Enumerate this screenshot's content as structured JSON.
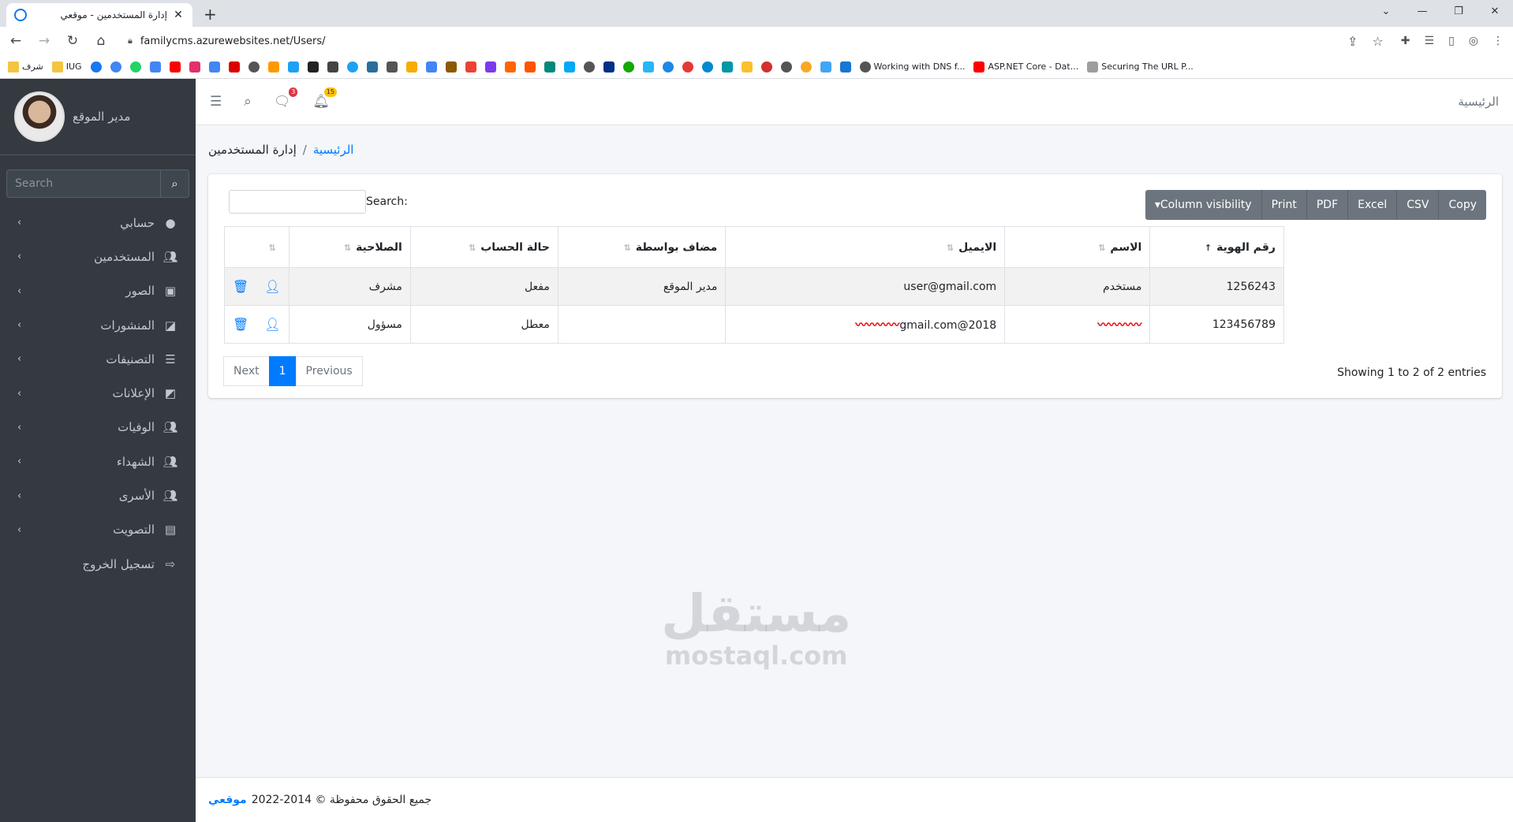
{
  "browser": {
    "tab_title": "إدارة المستخدمين - موقعي",
    "url": "familycms.azurewebsites.net/Users/",
    "bookmarks": [
      "شرف",
      "IUG",
      "Working with DNS f...",
      "ASP.NET Core - Dat...",
      "Securing The URL P..."
    ]
  },
  "sidebar": {
    "username": "مدير الموقع",
    "search_placeholder": "Search",
    "items": [
      {
        "label": "حسابي",
        "icon": "user-circle-icon"
      },
      {
        "label": "المستخدمين",
        "icon": "users-icon"
      },
      {
        "label": "الصور",
        "icon": "image-icon"
      },
      {
        "label": "المنشورات",
        "icon": "sticky-note-icon"
      },
      {
        "label": "التصنيفات",
        "icon": "list-icon"
      },
      {
        "label": "الإعلانات",
        "icon": "note-icon"
      },
      {
        "label": "الوفيات",
        "icon": "users-icon"
      },
      {
        "label": "الشهداء",
        "icon": "users-icon"
      },
      {
        "label": "الأسرى",
        "icon": "users-icon"
      },
      {
        "label": "التصويت",
        "icon": "chart-icon"
      },
      {
        "label": "تسجيل الخروج",
        "icon": "logout-icon"
      }
    ]
  },
  "topnav": {
    "home": "الرئيسية",
    "messages_count": "3",
    "notifications_count": "15"
  },
  "breadcrumb": {
    "home": "الرئيسية",
    "current": "إدارة المستخدمين"
  },
  "toolbar": {
    "copy": "Copy",
    "csv": "CSV",
    "excel": "Excel",
    "pdf": "PDF",
    "print": "Print",
    "colvis": "Column visibility",
    "search_label": "Search:"
  },
  "table": {
    "headers": [
      "رقم الهوية",
      "الاسم",
      "الايميل",
      "مضاف بواسطة",
      "حالة الحساب",
      "الصلاحية"
    ],
    "rows": [
      {
        "id": "1256243",
        "name": "مستخدم",
        "email": "user@gmail.com",
        "added_by": "مدير الموقع",
        "status": "مفعل",
        "role": "مشرف"
      },
      {
        "id": "123456789",
        "name": "",
        "email": "2018@gmail.com",
        "added_by": "",
        "status": "معطل",
        "role": "مسؤول"
      }
    ]
  },
  "info": "Showing 1 to 2 of 2 entries",
  "pagination": {
    "previous": "Previous",
    "page": "1",
    "next": "Next"
  },
  "footer": {
    "text": "جميع الحقوق محفوظة © 2014-2022",
    "brand": "موقعي"
  },
  "watermark": {
    "ar": "مستقل",
    "en": "mostaql.com"
  }
}
